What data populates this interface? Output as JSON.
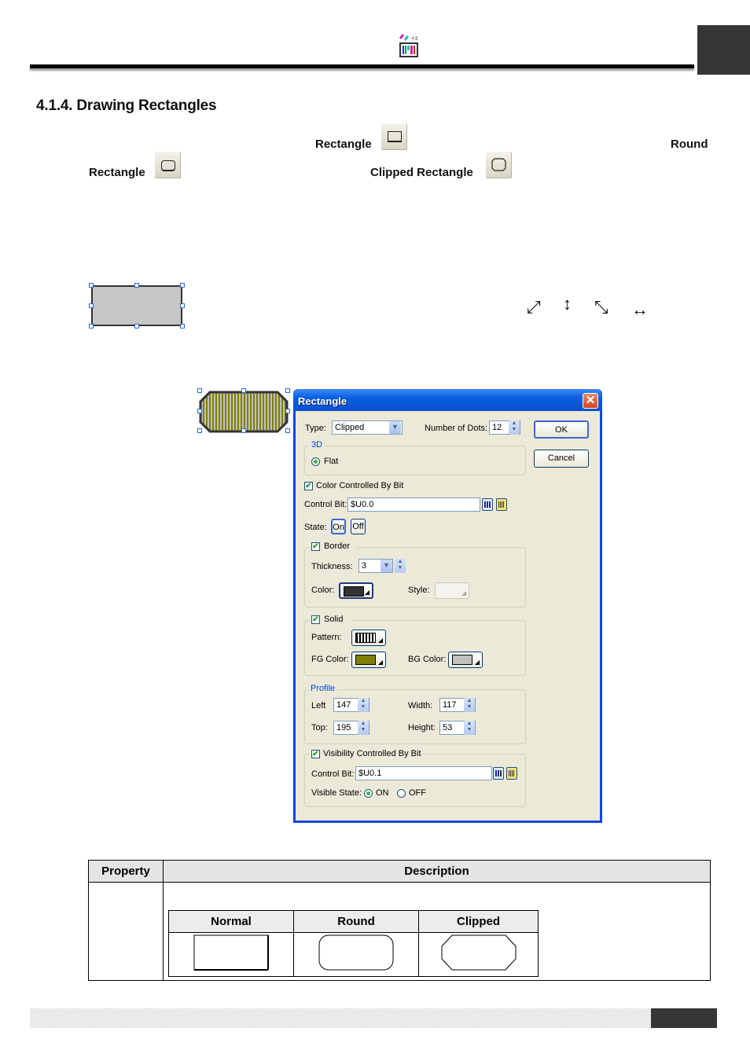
{
  "header": {
    "app_icon": "palette-grid-icon"
  },
  "section": {
    "title": "4.1.4. Drawing Rectangles",
    "tools": [
      {
        "label": "Rectangle",
        "icon": "rectangle-tool-icon"
      },
      {
        "label": "Round",
        "label_cont": "Rectangle",
        "icon": "round-rectangle-tool-icon"
      },
      {
        "label": "Clipped Rectangle",
        "icon": "clipped-rectangle-tool-icon"
      }
    ]
  },
  "resize_cursors": [
    "↗↙ diagonal",
    "↕ vertical",
    "↖↘ diagonal",
    "↔ horizontal"
  ],
  "dialog": {
    "title": "Rectangle",
    "close": "✕",
    "type_label": "Type:",
    "type_value": "Clipped",
    "dots_label": "Number of Dots:",
    "dots_value": "12",
    "ok": "OK",
    "cancel": "Cancel",
    "group_3d": "3D",
    "flat": "Flat",
    "color_controlled": "Color Controlled By Bit",
    "control_bit_label": "Control Bit:",
    "control_bit_value": "$U0.0",
    "state_label": "State:",
    "state_on": "On",
    "state_off": "Off",
    "border": {
      "label": "Border",
      "thickness_label": "Thickness:",
      "thickness_value": "3",
      "color_label": "Color:",
      "color": "#333333",
      "style_label": "Style:"
    },
    "solid": {
      "label": "Solid",
      "pattern_label": "Pattern:",
      "fg_label": "FG Color:",
      "fg_color": "#808000",
      "bg_label": "BG Color:",
      "bg_color": "#c0c0c0"
    },
    "profile": {
      "label": "Profile",
      "left_label": "Left",
      "left_value": "147",
      "top_label": "Top:",
      "top_value": "195",
      "width_label": "Width:",
      "width_value": "117",
      "height_label": "Height:",
      "height_value": "53"
    },
    "visibility": {
      "label": "Visibility Controlled By Bit",
      "control_bit_label": "Control Bit:",
      "control_bit_value": "$U0.1",
      "visible_state_label": "Visible State:",
      "on": "ON",
      "off": "OFF"
    }
  },
  "table": {
    "headers": [
      "Property",
      "Description"
    ],
    "shape_headers": [
      "Normal",
      "Round",
      "Clipped"
    ]
  }
}
